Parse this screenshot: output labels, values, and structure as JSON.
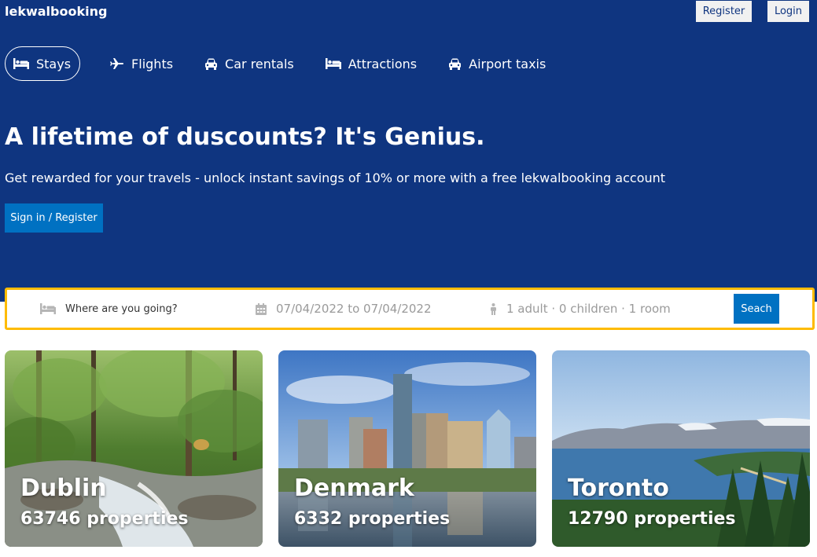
{
  "header": {
    "logo": "lekwalbooking",
    "register_label": "Register",
    "login_label": "Login"
  },
  "nav": {
    "items": [
      {
        "label": "Stays",
        "icon": "bed-icon",
        "active": true
      },
      {
        "label": "Flights",
        "icon": "plane-icon",
        "active": false
      },
      {
        "label": "Car rentals",
        "icon": "car-icon",
        "active": false
      },
      {
        "label": "Attractions",
        "icon": "bed-icon",
        "active": false
      },
      {
        "label": "Airport taxis",
        "icon": "car-icon",
        "active": false
      }
    ]
  },
  "hero": {
    "headline": "A lifetime of duscounts? It's Genius.",
    "subline": "Get rewarded for your travels - unlock instant savings of 10% or more with a free lekwalbooking account",
    "signin_label": "Sign in / Register"
  },
  "search": {
    "destination_placeholder": "Where are you going?",
    "dates": "07/04/2022 to 07/04/2022",
    "guests": "1 adult · 0 children · 1 room",
    "button_label": "Seach"
  },
  "destinations": [
    {
      "name": "Dublin",
      "properties": "63746 properties"
    },
    {
      "name": "Denmark",
      "properties": "6332 properties"
    },
    {
      "name": "Toronto",
      "properties": "12790 properties"
    }
  ],
  "colors": {
    "hero_bg": "#0f3580",
    "primary_button": "#0071c2",
    "search_border": "#febb02"
  }
}
